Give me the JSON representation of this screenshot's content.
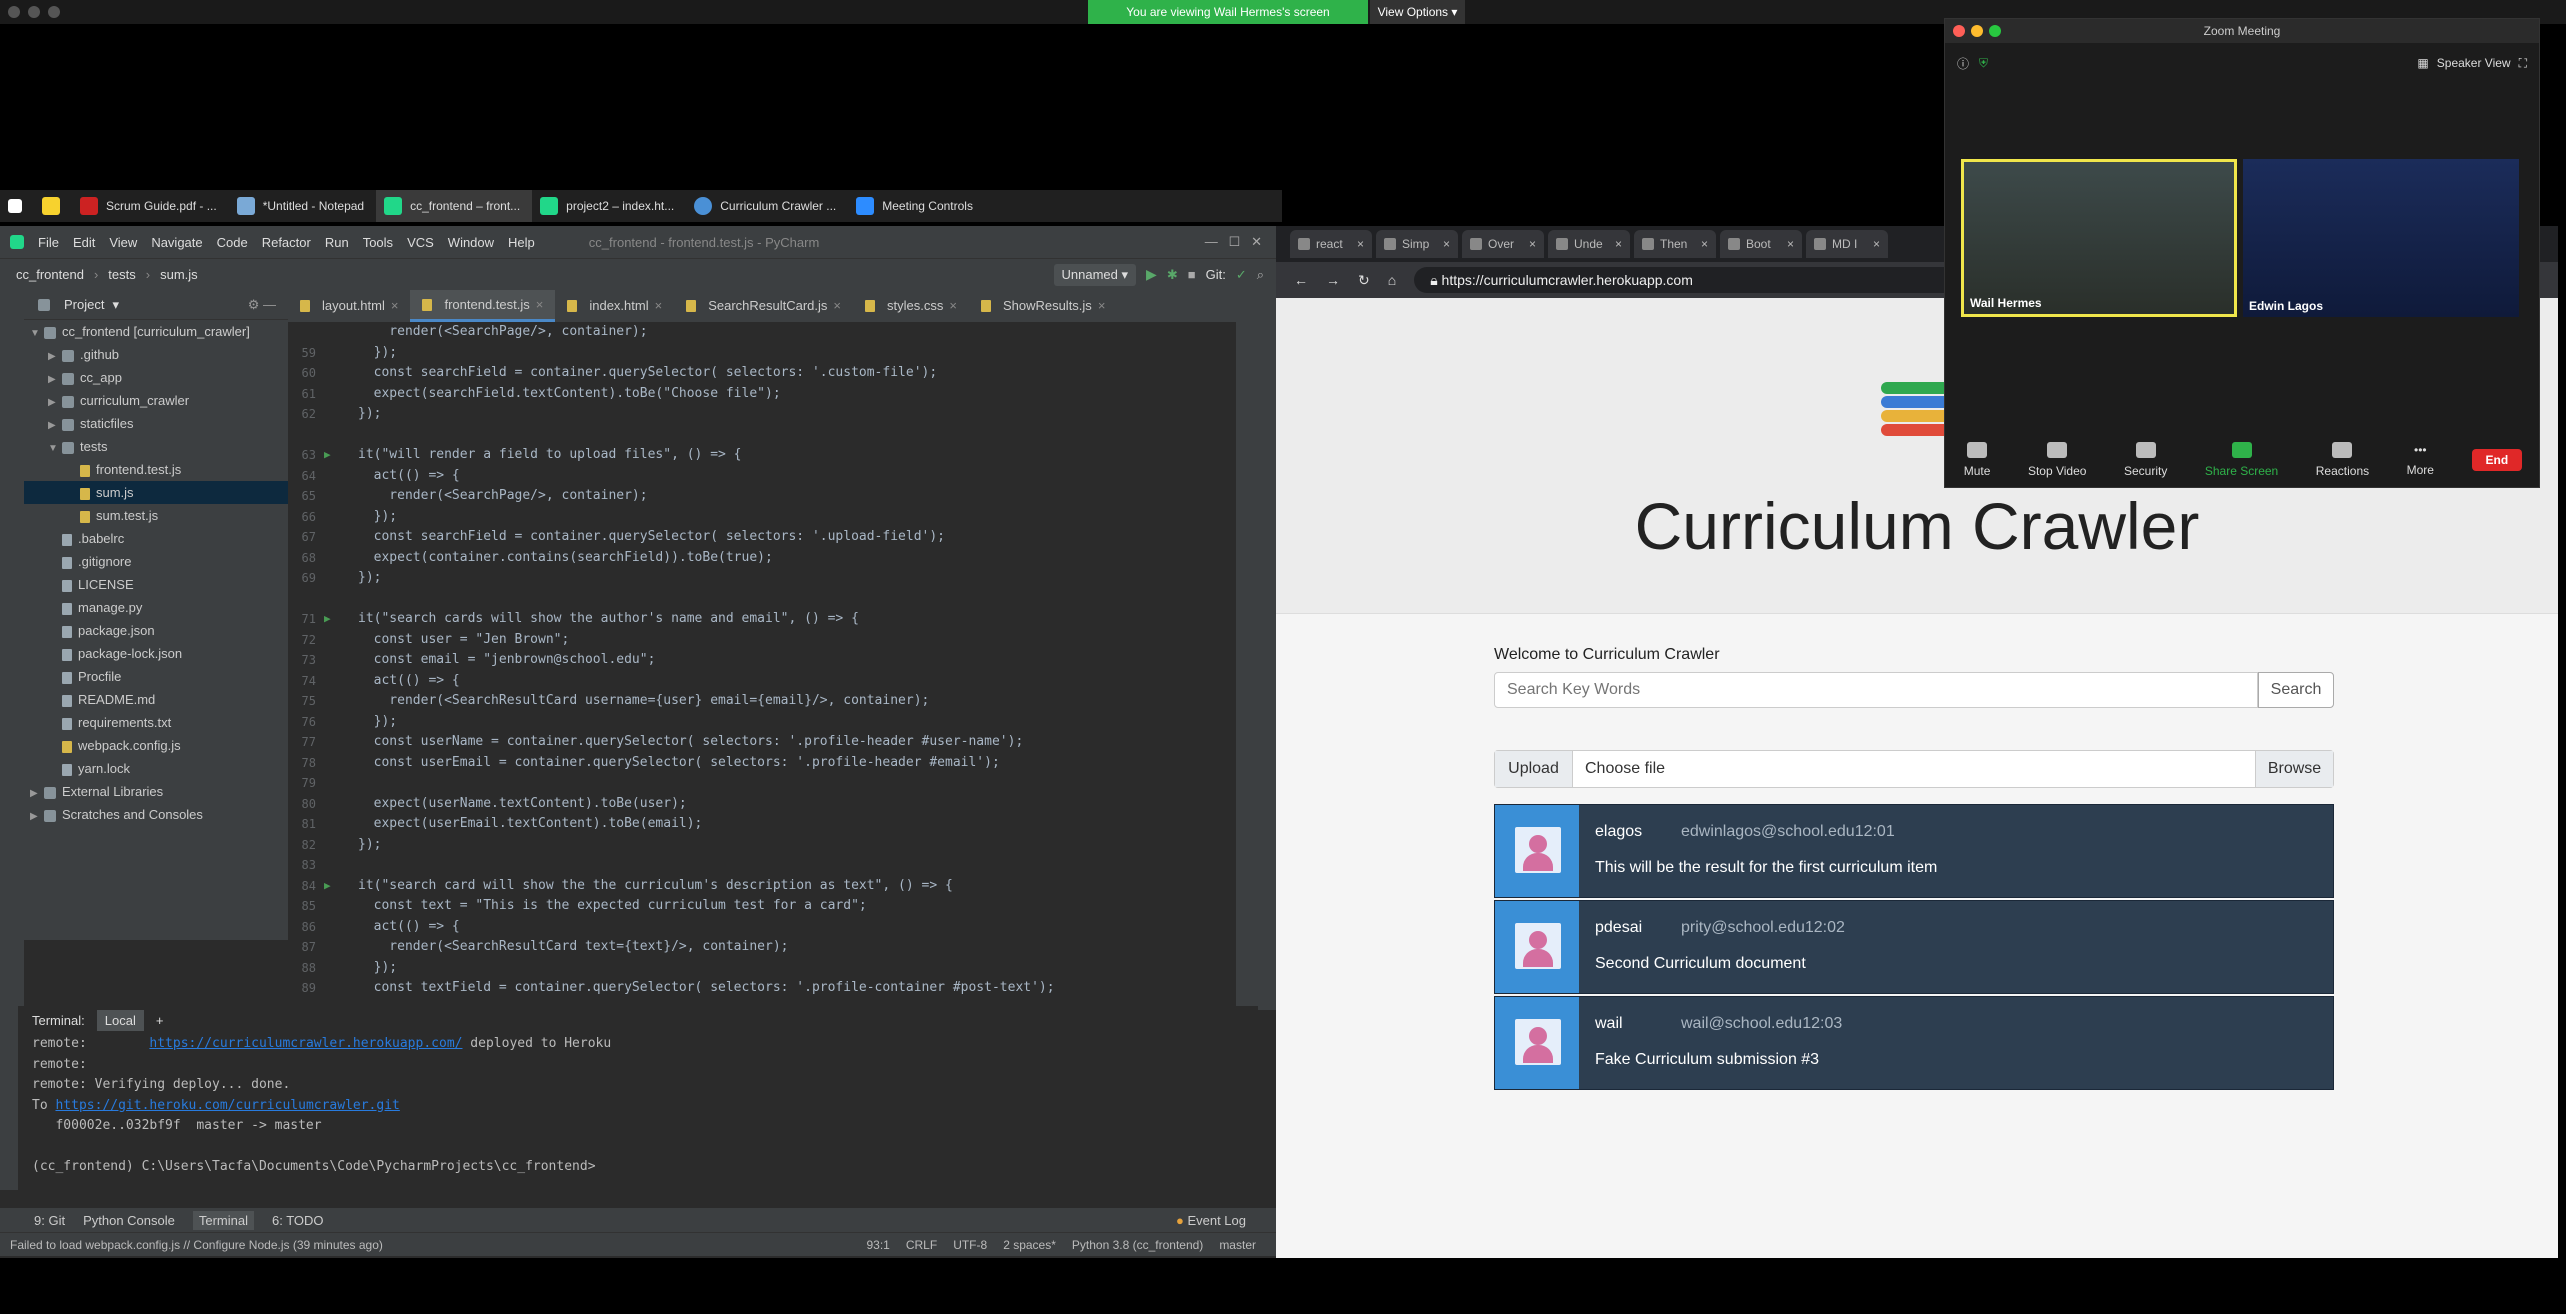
{
  "share": {
    "banner": "You are viewing Wail Hermes's screen",
    "view_options": "View Options"
  },
  "taskbar": {
    "items": [
      {
        "label": "Scrum Guide.pdf - ..."
      },
      {
        "label": "*Untitled - Notepad"
      },
      {
        "label": "cc_frontend – front..."
      },
      {
        "label": "project2 – index.ht..."
      },
      {
        "label": "Curriculum Crawler ..."
      },
      {
        "label": "Meeting Controls"
      }
    ]
  },
  "pycharm": {
    "menu": [
      "File",
      "Edit",
      "View",
      "Navigate",
      "Code",
      "Refactor",
      "Run",
      "Tools",
      "VCS",
      "Window",
      "Help"
    ],
    "window_title": "cc_frontend - frontend.test.js - PyCharm",
    "breadcrumb": [
      "cc_frontend",
      "tests",
      "sum.js"
    ],
    "run_config": "Unnamed",
    "git_label": "Git:",
    "project_label": "Project",
    "tree": [
      {
        "label": "cc_frontend [curriculum_crawler]",
        "kind": "folder",
        "depth": 0,
        "open": true
      },
      {
        "label": ".github",
        "kind": "folder",
        "depth": 1
      },
      {
        "label": "cc_app",
        "kind": "folder",
        "depth": 1
      },
      {
        "label": "curriculum_crawler",
        "kind": "folder",
        "depth": 1
      },
      {
        "label": "staticfiles",
        "kind": "folder",
        "depth": 1
      },
      {
        "label": "tests",
        "kind": "folder",
        "depth": 1,
        "open": true
      },
      {
        "label": "frontend.test.js",
        "kind": "js",
        "depth": 2
      },
      {
        "label": "sum.js",
        "kind": "js",
        "depth": 2,
        "selected": true
      },
      {
        "label": "sum.test.js",
        "kind": "js",
        "depth": 2
      },
      {
        "label": ".babelrc",
        "kind": "file",
        "depth": 1
      },
      {
        "label": ".gitignore",
        "kind": "file",
        "depth": 1
      },
      {
        "label": "LICENSE",
        "kind": "file",
        "depth": 1
      },
      {
        "label": "manage.py",
        "kind": "file",
        "depth": 1
      },
      {
        "label": "package.json",
        "kind": "file",
        "depth": 1
      },
      {
        "label": "package-lock.json",
        "kind": "file",
        "depth": 1
      },
      {
        "label": "Procfile",
        "kind": "file",
        "depth": 1
      },
      {
        "label": "README.md",
        "kind": "file",
        "depth": 1
      },
      {
        "label": "requirements.txt",
        "kind": "file",
        "depth": 1
      },
      {
        "label": "webpack.config.js",
        "kind": "js",
        "depth": 1
      },
      {
        "label": "yarn.lock",
        "kind": "file",
        "depth": 1
      },
      {
        "label": "External Libraries",
        "kind": "folder",
        "depth": 0
      },
      {
        "label": "Scratches and Consoles",
        "kind": "folder",
        "depth": 0
      }
    ],
    "tabs": [
      "layout.html",
      "frontend.test.js",
      "index.html",
      "SearchResultCard.js",
      "styles.css",
      "ShowResults.js"
    ],
    "code": [
      {
        "n": "",
        "text": "    render(<SearchPage/>, container);"
      },
      {
        "n": "59",
        "text": "  });"
      },
      {
        "n": "60",
        "text": "  const searchField = container.querySelector( selectors: '.custom-file');"
      },
      {
        "n": "61",
        "text": "  expect(searchField.textContent).toBe(\"Choose file\");"
      },
      {
        "n": "62",
        "text": "});"
      },
      {
        "n": "",
        "text": ""
      },
      {
        "n": "63",
        "text": "it(\"will render a field to upload files\", () => {"
      },
      {
        "n": "64",
        "text": "  act(() => {"
      },
      {
        "n": "65",
        "text": "    render(<SearchPage/>, container);"
      },
      {
        "n": "66",
        "text": "  });"
      },
      {
        "n": "67",
        "text": "  const searchField = container.querySelector( selectors: '.upload-field');"
      },
      {
        "n": "68",
        "text": "  expect(container.contains(searchField)).toBe(true);"
      },
      {
        "n": "69",
        "text": "});"
      },
      {
        "n": "",
        "text": ""
      },
      {
        "n": "71",
        "text": "it(\"search cards will show the author's name and email\", () => {"
      },
      {
        "n": "72",
        "text": "  const user = \"Jen Brown\";"
      },
      {
        "n": "73",
        "text": "  const email = \"jenbrown@school.edu\";"
      },
      {
        "n": "74",
        "text": "  act(() => {"
      },
      {
        "n": "75",
        "text": "    render(<SearchResultCard username={user} email={email}/>, container);"
      },
      {
        "n": "76",
        "text": "  });"
      },
      {
        "n": "77",
        "text": "  const userName = container.querySelector( selectors: '.profile-header #user-name');"
      },
      {
        "n": "78",
        "text": "  const userEmail = container.querySelector( selectors: '.profile-header #email');"
      },
      {
        "n": "79",
        "text": ""
      },
      {
        "n": "80",
        "text": "  expect(userName.textContent).toBe(user);"
      },
      {
        "n": "81",
        "text": "  expect(userEmail.textContent).toBe(email);"
      },
      {
        "n": "82",
        "text": "});"
      },
      {
        "n": "83",
        "text": ""
      },
      {
        "n": "84",
        "text": "it(\"search card will show the the curriculum's description as text\", () => {"
      },
      {
        "n": "85",
        "text": "  const text = \"This is the expected curriculum test for a card\";"
      },
      {
        "n": "86",
        "text": "  act(() => {"
      },
      {
        "n": "87",
        "text": "    render(<SearchResultCard text={text}/>, container);"
      },
      {
        "n": "88",
        "text": "  });"
      },
      {
        "n": "89",
        "text": "  const textField = container.querySelector( selectors: '.profile-container #post-text');"
      }
    ],
    "terminal": {
      "label": "Terminal:",
      "tab": "Local",
      "lines": [
        {
          "pre": "remote:        ",
          "link": "https://curriculumcrawler.herokuapp.com/",
          "post": " deployed to Heroku"
        },
        {
          "pre": "remote:",
          "link": "",
          "post": ""
        },
        {
          "pre": "remote: Verifying deploy... done.",
          "link": "",
          "post": ""
        },
        {
          "pre": "To ",
          "link": "https://git.heroku.com/curriculumcrawler.git",
          "post": ""
        },
        {
          "pre": "   f00002e..032bf9f  master -> master",
          "link": "",
          "post": ""
        },
        {
          "pre": "",
          "link": "",
          "post": ""
        },
        {
          "pre": "(cc_frontend) C:\\Users\\Tacfa\\Documents\\Code\\PycharmProjects\\cc_frontend>",
          "link": "",
          "post": ""
        }
      ]
    },
    "toolwindows": [
      "9: Git",
      "Python Console",
      "Terminal",
      "6: TODO"
    ],
    "event_log": "Event Log",
    "status_left": "Failed to load webpack.config.js // Configure Node.js (39 minutes ago)",
    "status_right": [
      "93:1",
      "CRLF",
      "UTF-8",
      "2 spaces*",
      "Python 3.8 (cc_frontend)",
      "master"
    ]
  },
  "browser": {
    "tabs": [
      "react",
      "Simp",
      "Over",
      "Unde",
      "Then",
      "Boot",
      "MD I"
    ],
    "url": "https://curriculumcrawler.herokuapp.com",
    "title": "Curriculum Crawler",
    "welcome": "Welcome to Curriculum Crawler",
    "search_placeholder": "Search Key Words",
    "search_button": "Search",
    "upload_label": "Upload",
    "choose_file": "Choose file",
    "browse": "Browse",
    "results": [
      {
        "user": "elagos",
        "email": "edwinlagos@school.edu12:01",
        "text": "This will be the result for the first curriculum item"
      },
      {
        "user": "pdesai",
        "email": "prity@school.edu12:02",
        "text": "Second Curriculum document"
      },
      {
        "user": "wail",
        "email": "wail@school.edu12:03",
        "text": "Fake Curriculum submission #3"
      }
    ]
  },
  "zoom": {
    "title": "Zoom Meeting",
    "speaker_view": "Speaker View",
    "participants": [
      "Wail Hermes",
      "Edwin Lagos"
    ],
    "controls": [
      "Mute",
      "Stop Video",
      "Security",
      "Share Screen",
      "Reactions",
      "More"
    ],
    "end": "End"
  }
}
